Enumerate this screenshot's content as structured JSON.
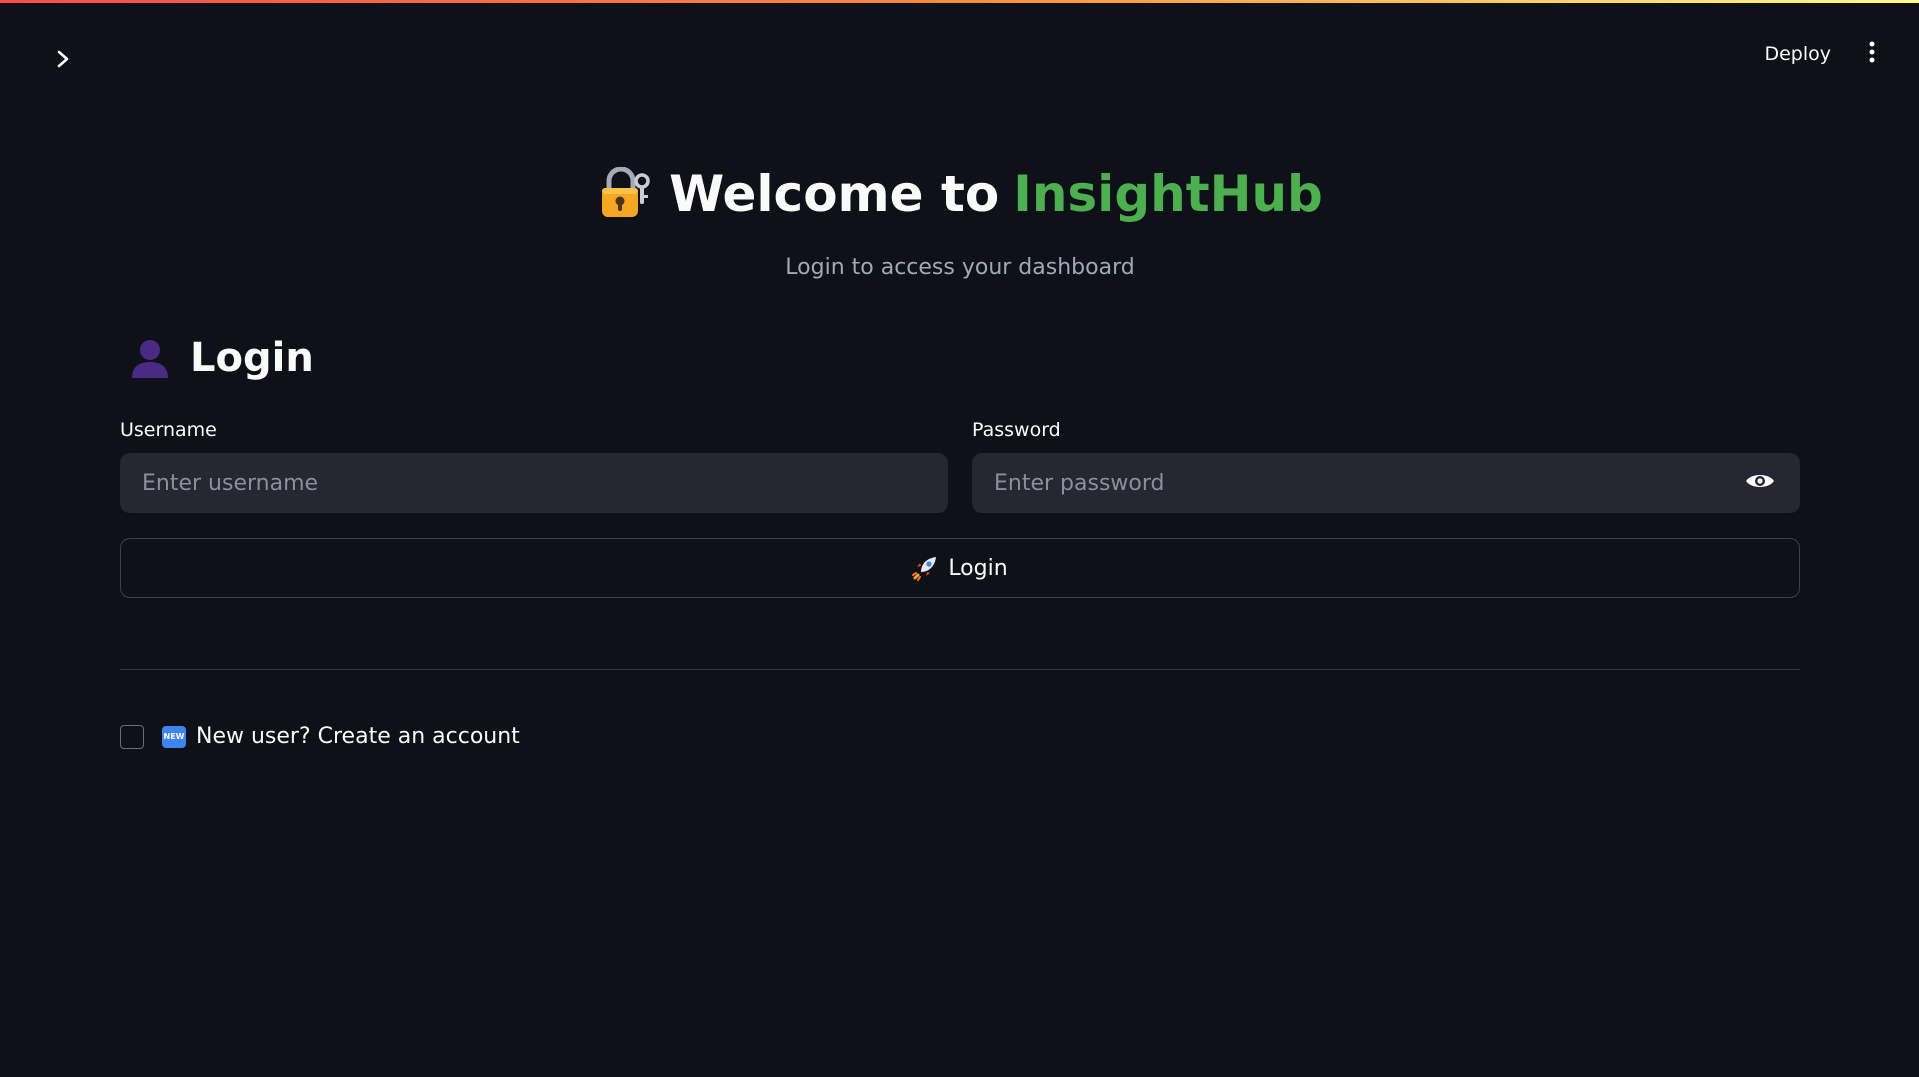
{
  "header": {
    "deploy_label": "Deploy",
    "sidebar_toggle_icon": "chevron-right-icon",
    "menu_icon": "vertical-ellipsis-icon"
  },
  "hero": {
    "title_prefix": "Welcome to",
    "title_brand": "InsightHub",
    "subtitle": "Login to access your dashboard",
    "lock_icon": "locked-with-key-icon",
    "brand_color": "#4caf50"
  },
  "login": {
    "heading": "Login",
    "heading_icon": "bust-in-silhouette-icon",
    "username": {
      "label": "Username",
      "placeholder": "Enter username",
      "value": ""
    },
    "password": {
      "label": "Password",
      "placeholder": "Enter password",
      "value": "",
      "toggle_icon": "eye-icon"
    },
    "submit_label": "Login",
    "submit_icon": "rocket-icon"
  },
  "signup": {
    "checked": false,
    "badge_icon": "new-button-icon",
    "badge_text": "NEW",
    "label": "New user? Create an account"
  },
  "colors": {
    "background": "#0e1117",
    "input_background": "#262730",
    "accent_gradient": [
      "#ff4b4b",
      "#fffd80"
    ]
  }
}
